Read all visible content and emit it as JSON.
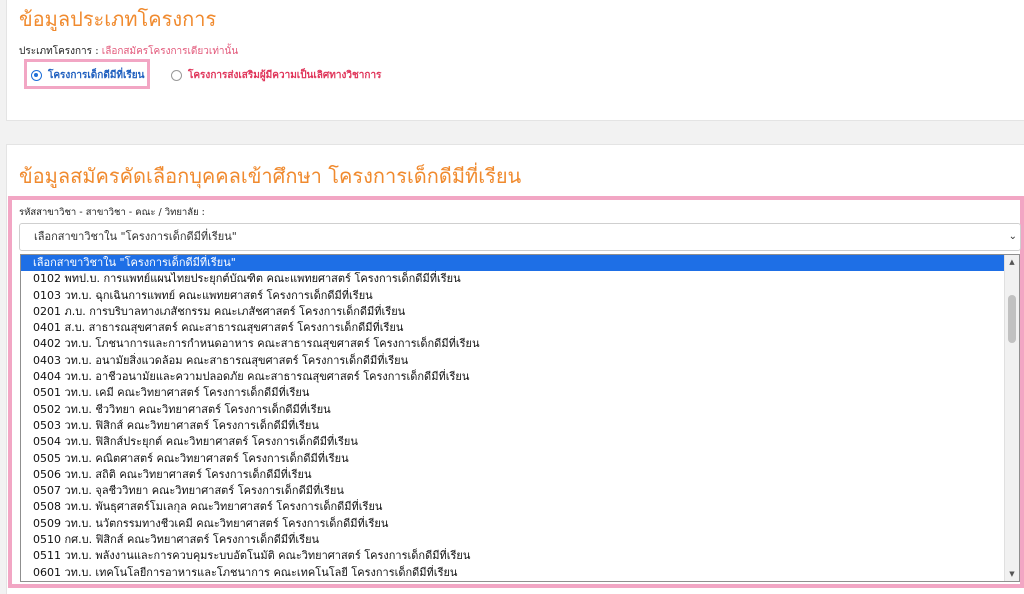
{
  "section1": {
    "title": "ข้อมูลประเภทโครงการ",
    "type_label": "ประเภทโครงการ :",
    "type_hint": "เลือกสมัครโครงการเดียวเท่านั้น",
    "options": [
      {
        "label": "โครงการเด็กดีมีที่เรียน",
        "checked": true
      },
      {
        "label": "โครงการส่งเสริมผู้มีความเป็นเลิศทางวิชาการ",
        "checked": false
      }
    ]
  },
  "section2": {
    "title": "ข้อมูลสมัครคัดเลือกบุคคลเข้าศึกษา โครงการเด็กดีมีที่เรียน",
    "field_label": "รหัสสาขาวิชา - สาขาวิชา - คณะ / วิทยาลัย :",
    "select_value": "เลือกสาขาวิชาใน \"โครงการเด็กดีมีที่เรียน\"",
    "options": [
      "เลือกสาขาวิชาใน \"โครงการเด็กดีมีที่เรียน\"",
      "0102 พทป.บ. การแพทย์แผนไทยประยุกต์บัณฑิต คณะแพทยศาสตร์ โครงการเด็กดีมีที่เรียน",
      "0103 วท.บ. ฉุกเฉินการแพทย์ คณะแพทยศาสตร์ โครงการเด็กดีมีที่เรียน",
      "0201 ภ.บ. การบริบาลทางเภสัชกรรม คณะเภสัชศาสตร์ โครงการเด็กดีมีที่เรียน",
      "0401 ส.บ. สาธารณสุขศาสตร์ คณะสาธารณสุขศาสตร์ โครงการเด็กดีมีที่เรียน",
      "0402 วท.บ. โภชนาการและการกำหนดอาหาร คณะสาธารณสุขศาสตร์ โครงการเด็กดีมีที่เรียน",
      "0403 วท.บ. อนามัยสิ่งแวดล้อม คณะสาธารณสุขศาสตร์ โครงการเด็กดีมีที่เรียน",
      "0404 วท.บ. อาชีวอนามัยและความปลอดภัย คณะสาธารณสุขศาสตร์ โครงการเด็กดีมีที่เรียน",
      "0501 วท.บ. เคมี คณะวิทยาศาสตร์ โครงการเด็กดีมีที่เรียน",
      "0502 วท.บ. ชีววิทยา คณะวิทยาศาสตร์ โครงการเด็กดีมีที่เรียน",
      "0503 วท.บ. ฟิสิกส์ คณะวิทยาศาสตร์ โครงการเด็กดีมีที่เรียน",
      "0504 วท.บ. ฟิสิกส์ประยุกต์ คณะวิทยาศาสตร์ โครงการเด็กดีมีที่เรียน",
      "0505 วท.บ. คณิตศาสตร์ คณะวิทยาศาสตร์ โครงการเด็กดีมีที่เรียน",
      "0506 วท.บ. สถิติ คณะวิทยาศาสตร์ โครงการเด็กดีมีที่เรียน",
      "0507 วท.บ. จุลชีววิทยา คณะวิทยาศาสตร์ โครงการเด็กดีมีที่เรียน",
      "0508 วท.บ. พันธุศาสตร์โมเลกุล คณะวิทยาศาสตร์ โครงการเด็กดีมีที่เรียน",
      "0509 วท.บ. นวัตกรรมทางชีวเคมี คณะวิทยาศาสตร์ โครงการเด็กดีมีที่เรียน",
      "0510 กศ.บ. ฟิสิกส์ คณะวิทยาศาสตร์ โครงการเด็กดีมีที่เรียน",
      "0511 วท.บ. พลังงานและการควบคุมระบบอัตโนมัติ คณะวิทยาศาสตร์ โครงการเด็กดีมีที่เรียน",
      "0601 วท.บ. เทคโนโลยีการอาหารและโภชนาการ คณะเทคโนโลยี โครงการเด็กดีมีที่เรียน"
    ]
  }
}
